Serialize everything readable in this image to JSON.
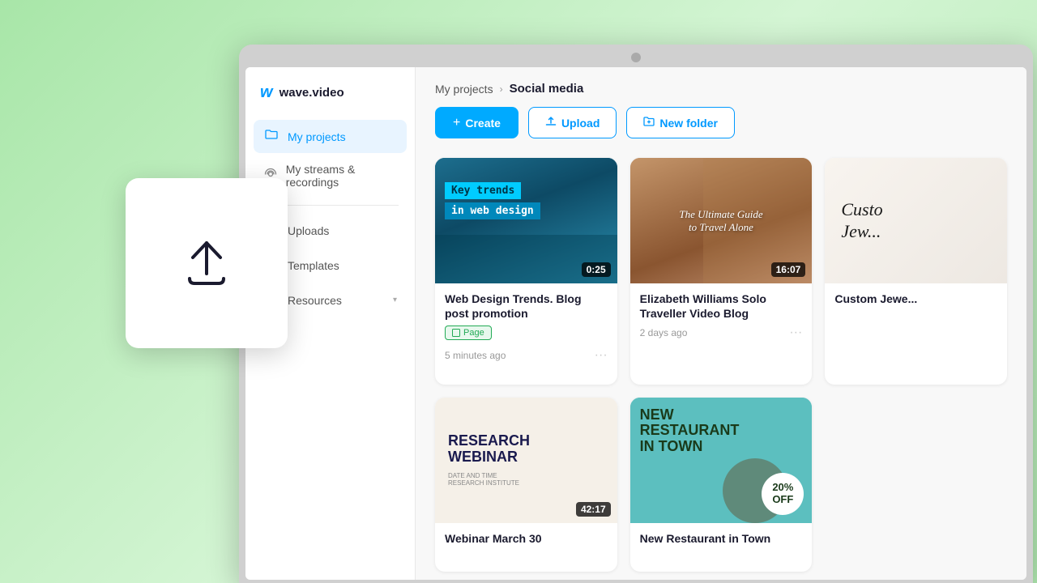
{
  "app": {
    "logo_w": "w",
    "logo_text": "wave.video"
  },
  "sidebar": {
    "items": [
      {
        "id": "my-projects",
        "label": "My projects",
        "icon": "folder",
        "active": true
      },
      {
        "id": "my-streams",
        "label": "My streams & recordings",
        "icon": "streams",
        "active": false
      },
      {
        "id": "uploads",
        "label": "Uploads",
        "icon": "upload",
        "active": false
      },
      {
        "id": "templates",
        "label": "Templates",
        "icon": "templates",
        "active": false
      },
      {
        "id": "resources",
        "label": "Resources",
        "icon": "resources",
        "active": false
      }
    ]
  },
  "breadcrumb": {
    "parent": "My projects",
    "current": "Social media"
  },
  "toolbar": {
    "create_label": "Create",
    "upload_label": "Upload",
    "new_folder_label": "New folder"
  },
  "cards": [
    {
      "id": "card-1",
      "title": "Web Design Trends. Blog post promotion",
      "duration": "0:25",
      "badge": "Page",
      "time": "5 minutes ago",
      "thumb_type": "web-design"
    },
    {
      "id": "card-2",
      "title": "Elizabeth Williams Solo Traveller Video Blog",
      "duration": "16:07",
      "badge": null,
      "time": "2 days ago",
      "thumb_type": "travel"
    },
    {
      "id": "card-3",
      "title": "Custom Jewe...",
      "duration": null,
      "badge": null,
      "time": null,
      "thumb_type": "jewelry"
    },
    {
      "id": "card-4",
      "title": "Webinar March 30",
      "duration": "42:17",
      "badge": null,
      "time": "",
      "thumb_type": "webinar"
    },
    {
      "id": "card-5",
      "title": "New Restaurant in Town",
      "duration": null,
      "badge": null,
      "time": "",
      "thumb_type": "restaurant"
    }
  ],
  "upload_overlay": {
    "visible": true
  }
}
